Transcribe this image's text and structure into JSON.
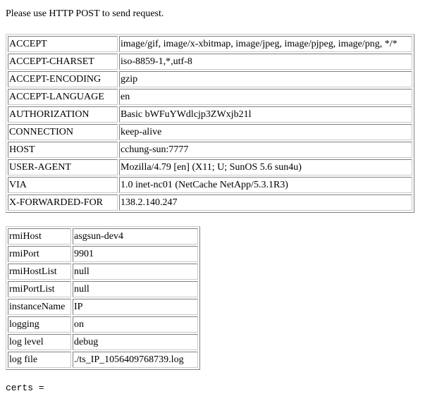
{
  "intro_text": "Please use HTTP POST to send request.",
  "headers_table": {
    "rows": [
      {
        "key": "ACCEPT",
        "value": "image/gif, image/x-xbitmap, image/jpeg, image/pjpeg, image/png, */*"
      },
      {
        "key": "ACCEPT-CHARSET",
        "value": "iso-8859-1,*,utf-8"
      },
      {
        "key": "ACCEPT-ENCODING",
        "value": "gzip"
      },
      {
        "key": "ACCEPT-LANGUAGE",
        "value": "en"
      },
      {
        "key": "AUTHORIZATION",
        "value": "Basic bWFuYWdlcjp3ZWxjb21l"
      },
      {
        "key": "CONNECTION",
        "value": "keep-alive"
      },
      {
        "key": "HOST",
        "value": "cchung-sun:7777"
      },
      {
        "key": "USER-AGENT",
        "value": "Mozilla/4.79 [en] (X11; U; SunOS 5.6 sun4u)"
      },
      {
        "key": "VIA",
        "value": "1.0 inet-nc01 (NetCache NetApp/5.3.1R3)"
      },
      {
        "key": "X-FORWARDED-FOR",
        "value": "138.2.140.247"
      }
    ]
  },
  "config_table": {
    "rows": [
      {
        "key": "rmiHost",
        "value": "asgsun-dev4"
      },
      {
        "key": "rmiPort",
        "value": "9901"
      },
      {
        "key": "rmiHostList",
        "value": "null"
      },
      {
        "key": "rmiPortList",
        "value": "null"
      },
      {
        "key": "instanceName",
        "value": "IP"
      },
      {
        "key": "logging",
        "value": "on"
      },
      {
        "key": "log level",
        "value": "debug"
      },
      {
        "key": "log file",
        "value": "./ts_IP_1056409768739.log"
      }
    ]
  },
  "certs_text": "certs ="
}
